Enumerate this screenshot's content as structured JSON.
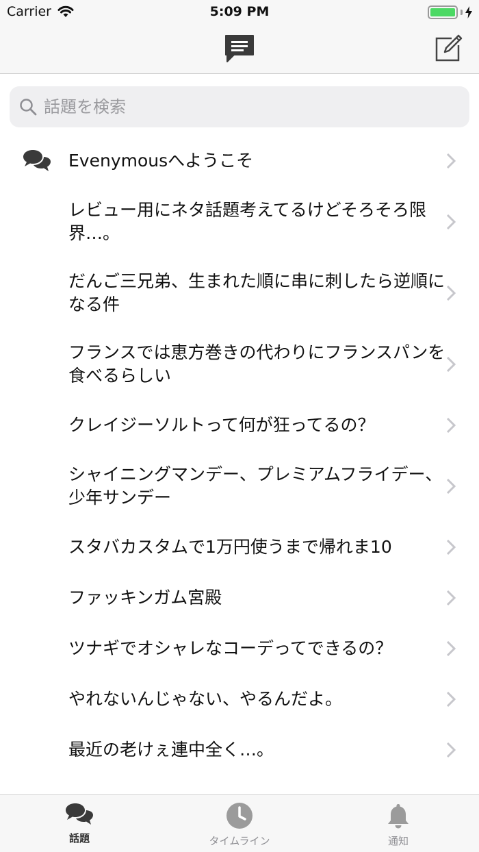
{
  "status_bar": {
    "carrier": "Carrier",
    "time": "5:09 PM",
    "battery_level": 1.0
  },
  "nav": {
    "logo_icon": "chat-bubble-icon",
    "compose_icon": "compose-icon"
  },
  "search": {
    "placeholder": "話題を検索",
    "value": ""
  },
  "topics": [
    {
      "title": "Evenymousへようこそ",
      "icon": "chat-bubbles-icon"
    },
    {
      "title": "レビュー用にネタ話題考えてるけどそろそろ限界…。"
    },
    {
      "title": "だんご三兄弟、生まれた順に串に刺したら逆順になる件"
    },
    {
      "title": "フランスでは恵方巻きの代わりにフランスパンを食べるらしい"
    },
    {
      "title": "クレイジーソルトって何が狂ってるの？"
    },
    {
      "title": "シャイニングマンデー、プレミアムフライデー、少年サンデー"
    },
    {
      "title": "スタバカスタムで1万円使うまで帰れま10"
    },
    {
      "title": "ファッキンガム宮殿"
    },
    {
      "title": "ツナギでオシャレなコーデってできるの？"
    },
    {
      "title": "やれないんじゃない、やるんだよ。"
    },
    {
      "title": "最近の老けぇ連中全く…。"
    }
  ],
  "tab_bar": {
    "tabs": [
      {
        "label": "話題",
        "icon": "chat-bubbles-icon",
        "active": true
      },
      {
        "label": "タイムライン",
        "icon": "clock-icon",
        "active": false
      },
      {
        "label": "通知",
        "icon": "bell-icon",
        "active": false
      }
    ]
  },
  "colors": {
    "bar_background": "#f7f7f7",
    "search_background": "#efeff1",
    "battery_green": "#4cd964",
    "chevron": "#c7c7cc",
    "inactive_tab": "#8e8e93",
    "active_tab": "#333333"
  }
}
